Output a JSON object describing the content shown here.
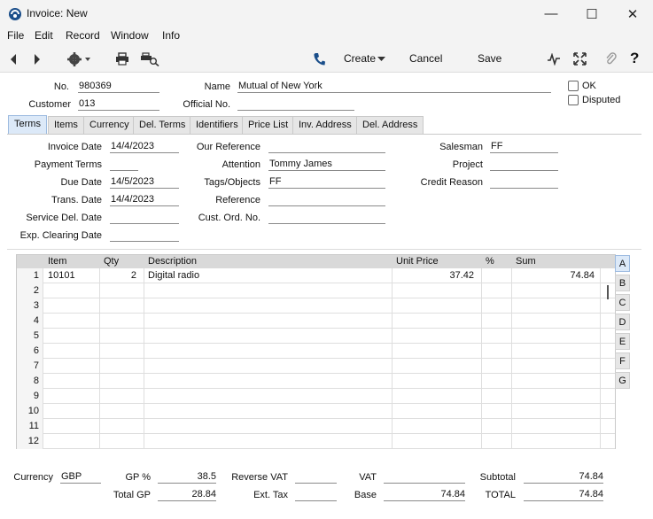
{
  "window": {
    "title": "Invoice: New",
    "minimize": "—",
    "maximize": "☐",
    "close": "✕"
  },
  "menu": {
    "items": [
      "File",
      "Edit",
      "Record",
      "Window",
      "Info"
    ],
    "underline": [
      "F",
      "E",
      "R",
      "W",
      "I"
    ]
  },
  "toolbar": {
    "create": "Create",
    "cancel": "Cancel",
    "save": "Save"
  },
  "header": {
    "no_label": "No.",
    "no_value": "980369",
    "name_label": "Name",
    "name_value": "Mutual of New York",
    "customer_label": "Customer",
    "customer_value": "013",
    "official_label": "Official No.",
    "official_value": "",
    "ok_label": "OK",
    "disputed_label": "Disputed"
  },
  "tabs": [
    "Terms",
    "Items",
    "Currency",
    "Del. Terms",
    "Identifiers",
    "Price List",
    "Inv. Address",
    "Del. Address"
  ],
  "terms": {
    "invoice_date_label": "Invoice Date",
    "invoice_date": "14/4/2023",
    "payment_terms_label": "Payment Terms",
    "payment_terms": "",
    "due_date_label": "Due Date",
    "due_date": "14/5/2023",
    "trans_date_label": "Trans. Date",
    "trans_date": "14/4/2023",
    "service_del_label": "Service Del. Date",
    "service_del": "",
    "exp_clearing_label": "Exp. Clearing Date",
    "exp_clearing": "",
    "our_ref_label": "Our Reference",
    "our_ref": "",
    "attention_label": "Attention",
    "attention": "Tommy James",
    "tags_label": "Tags/Objects",
    "tags": "FF",
    "reference_label": "Reference",
    "reference": "",
    "cust_ord_label": "Cust. Ord. No.",
    "cust_ord": "",
    "salesman_label": "Salesman",
    "salesman": "FF",
    "project_label": "Project",
    "project": "",
    "credit_reason_label": "Credit Reason",
    "credit_reason": ""
  },
  "grid": {
    "columns": [
      "Item",
      "Qty",
      "Description",
      "Unit Price",
      "%",
      "Sum"
    ],
    "rows": [
      {
        "n": "1",
        "item": "10101",
        "qty": "2",
        "desc": "Digital radio",
        "price": "37.42",
        "pct": "",
        "sum": "74.84"
      },
      {
        "n": "2",
        "item": "",
        "qty": "",
        "desc": "",
        "price": "",
        "pct": "",
        "sum": ""
      },
      {
        "n": "3",
        "item": "",
        "qty": "",
        "desc": "",
        "price": "",
        "pct": "",
        "sum": ""
      },
      {
        "n": "4",
        "item": "",
        "qty": "",
        "desc": "",
        "price": "",
        "pct": "",
        "sum": ""
      },
      {
        "n": "5",
        "item": "",
        "qty": "",
        "desc": "",
        "price": "",
        "pct": "",
        "sum": ""
      },
      {
        "n": "6",
        "item": "",
        "qty": "",
        "desc": "",
        "price": "",
        "pct": "",
        "sum": ""
      },
      {
        "n": "7",
        "item": "",
        "qty": "",
        "desc": "",
        "price": "",
        "pct": "",
        "sum": ""
      },
      {
        "n": "8",
        "item": "",
        "qty": "",
        "desc": "",
        "price": "",
        "pct": "",
        "sum": ""
      },
      {
        "n": "9",
        "item": "",
        "qty": "",
        "desc": "",
        "price": "",
        "pct": "",
        "sum": ""
      },
      {
        "n": "10",
        "item": "",
        "qty": "",
        "desc": "",
        "price": "",
        "pct": "",
        "sum": ""
      },
      {
        "n": "11",
        "item": "",
        "qty": "",
        "desc": "",
        "price": "",
        "pct": "",
        "sum": ""
      },
      {
        "n": "12",
        "item": "",
        "qty": "",
        "desc": "",
        "price": "",
        "pct": "",
        "sum": ""
      }
    ],
    "side_tabs": [
      "A",
      "B",
      "C",
      "D",
      "E",
      "F",
      "G"
    ]
  },
  "footer": {
    "currency_label": "Currency",
    "currency": "GBP",
    "gp_pct_label": "GP %",
    "gp_pct": "38.5",
    "total_gp_label": "Total GP",
    "total_gp": "28.84",
    "reverse_vat_label": "Reverse VAT",
    "reverse_vat": "",
    "ext_tax_label": "Ext. Tax",
    "ext_tax": "",
    "vat_label": "VAT",
    "vat": "",
    "base_label": "Base",
    "base": "74.84",
    "subtotal_label": "Subtotal",
    "subtotal": "74.84",
    "total_label": "TOTAL",
    "total": "74.84"
  },
  "colors": {
    "accent": "#1a5fb4",
    "active_tab": "#dce9f8",
    "chrome": "#f3f3f3"
  },
  "icons": [
    "app-icon",
    "back-icon",
    "forward-icon",
    "gear-icon",
    "printer-icon",
    "print-preview-icon",
    "phone-icon",
    "activity-icon",
    "expand-icon",
    "paperclip-icon",
    "help-icon"
  ]
}
